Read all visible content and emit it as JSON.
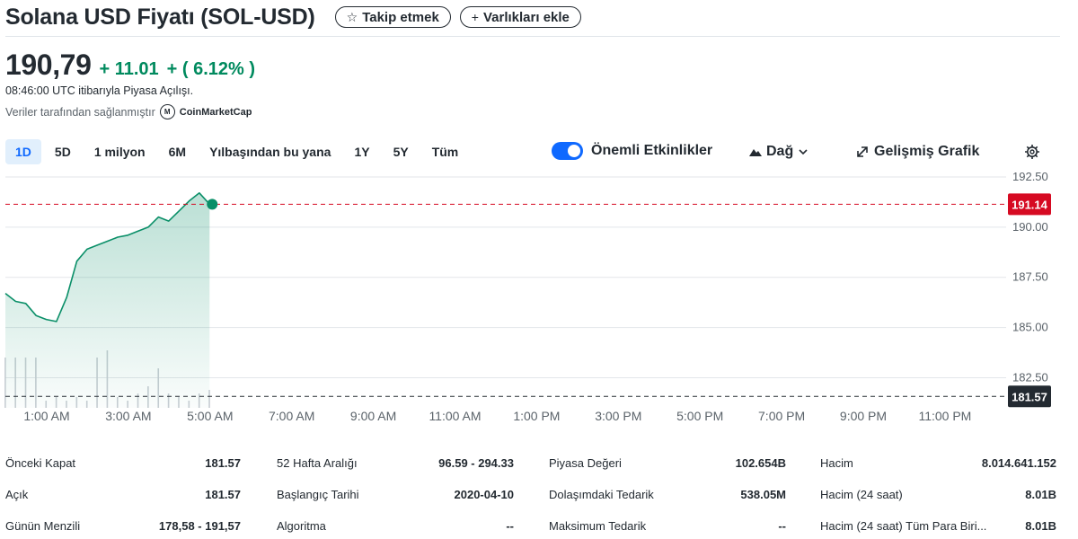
{
  "header": {
    "title": "Solana USD Fiyatı (SOL-USD)",
    "follow_label": "Takip etmek",
    "follow_icon": "☆",
    "add_label": "Varlıkları ekle",
    "add_icon": "+"
  },
  "quote": {
    "price": "190,79",
    "change": "+ 11.01",
    "change_pct": "+ ( 6.12% )",
    "as_of": "08:46:00 UTC itibarıyla Piyasa Açılışı.",
    "provider_label": "Veriler tarafından sağlanmıştır",
    "provider_name": "CoinMarketCap",
    "up_color": "#008a5e"
  },
  "range_tabs": [
    {
      "label": "1D",
      "active": true
    },
    {
      "label": "5D"
    },
    {
      "label": "1 milyon"
    },
    {
      "label": "6M"
    },
    {
      "label": "Yılbaşından bu yana"
    },
    {
      "label": "1Y"
    },
    {
      "label": "5Y"
    },
    {
      "label": "Tüm"
    }
  ],
  "controls": {
    "events_label": "Önemli Etkinlikler",
    "events_on": true,
    "chart_type_label": "Dağ",
    "advanced_label": "Gelişmiş Grafik",
    "settings_icon": "gear-icon"
  },
  "chart_data": {
    "type": "area",
    "ylim": [
      181.0,
      192.9
    ],
    "yticks": [
      192.5,
      190.0,
      187.5,
      185.0,
      182.5
    ],
    "ytick_labels": [
      "192.50",
      "190.00",
      "187.50",
      "185.00",
      "182.50"
    ],
    "xticks": [
      "1:00 AM",
      "3:00 AM",
      "5:00 AM",
      "7:00 AM",
      "9:00 AM",
      "11:00 AM",
      "1:00 PM",
      "3:00 PM",
      "5:00 PM",
      "7:00 PM",
      "9:00 PM",
      "11:00 PM"
    ],
    "x_hours": [
      0.0,
      0.25,
      0.5,
      0.75,
      1.0,
      1.25,
      1.5,
      1.75,
      2.0,
      2.25,
      2.5,
      2.75,
      3.0,
      3.25,
      3.5,
      3.75,
      4.0,
      4.25,
      4.5,
      4.75,
      5.0
    ],
    "values": [
      186.7,
      186.3,
      186.2,
      185.6,
      185.4,
      185.3,
      186.5,
      188.3,
      188.9,
      189.1,
      189.3,
      189.5,
      189.6,
      189.8,
      190.0,
      190.5,
      190.3,
      190.8,
      191.3,
      191.7,
      191.14
    ],
    "volume": [
      1.4,
      1.4,
      1.4,
      1.4,
      0.2,
      0.3,
      0.2,
      0.3,
      0.2,
      1.4,
      1.6,
      0.3,
      0.2,
      0.4,
      0.6,
      1.1,
      0.4,
      0.3,
      0.2,
      0.4,
      0.5
    ],
    "current_value": "191.14",
    "prev_close": "181.57",
    "line_color": "#0a8f68",
    "current_color": "#d60a22",
    "prev_color": "#232a31"
  },
  "stats": [
    [
      {
        "label": "Önceki Kapat",
        "value": "181.57"
      },
      {
        "label": "52 Hafta Aralığı",
        "value": "96.59 - 294.33"
      },
      {
        "label": "Piyasa Değeri",
        "value": "102.654B"
      },
      {
        "label": "Hacim",
        "value": "8.014.641.152"
      }
    ],
    [
      {
        "label": "Açık",
        "value": "181.57"
      },
      {
        "label": "Başlangıç Tarihi",
        "value": "2020-04-10"
      },
      {
        "label": "Dolaşımdaki Tedarik",
        "value": "538.05M"
      },
      {
        "label": "Hacim (24 saat)",
        "value": "8.01B"
      }
    ],
    [
      {
        "label": "Günün Menzili",
        "value": "178,58 - 191,57"
      },
      {
        "label": "Algoritma",
        "value": "--"
      },
      {
        "label": "Maksimum Tedarik",
        "value": "--"
      },
      {
        "label": "Hacim (24 saat) Tüm Para Biri...",
        "value": "8.01B"
      }
    ]
  ]
}
